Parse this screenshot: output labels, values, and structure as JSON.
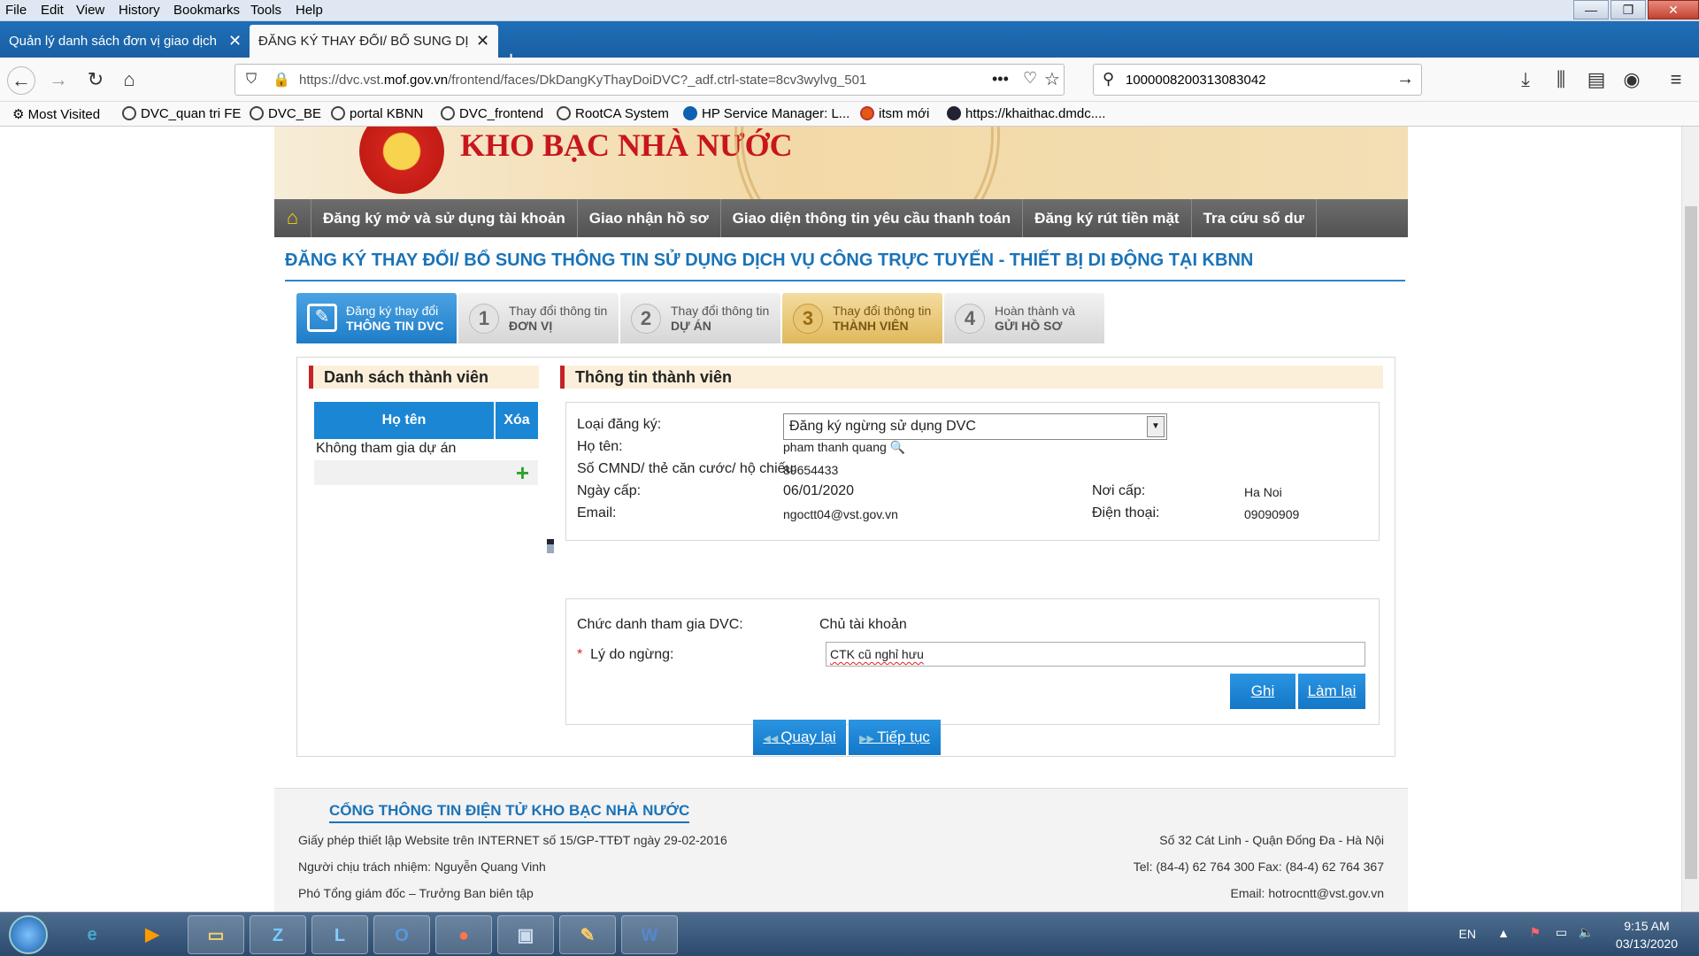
{
  "browser": {
    "menu": [
      "File",
      "Edit",
      "View",
      "History",
      "Bookmarks",
      "Tools",
      "Help"
    ],
    "tabs": [
      {
        "title": "Quản lý danh sách đơn vị giao dịch",
        "active": false
      },
      {
        "title": "ĐĂNG KÝ THAY ĐỔI/ BỔ SUNG DỊCH VỤ",
        "active": true
      }
    ],
    "url_prefix": "https://dvc.vst.",
    "url_domain": "mof.gov.vn",
    "url_rest": "/frontend/faces/DkDangKyThayDoiDVC?_adf.ctrl-state=8cv3wylvg_501",
    "search_value": "1000008200313083042",
    "bookmarks": [
      "Most Visited",
      "DVC_quan tri FE",
      "DVC_BE",
      "portal KBNN",
      "DVC_frontend",
      "RootCA System",
      "HP Service Manager: L...",
      "itsm mới",
      "https://khaithac.dmdc...."
    ]
  },
  "site": {
    "banner_title": "KHO BẠC NHÀ NƯỚC",
    "menu": [
      "Đăng ký mở và sử dụng tài khoản",
      "Giao nhận hồ sơ",
      "Giao diện thông tin yêu cầu thanh toán",
      "Đăng ký rút tiền mặt",
      "Tra cứu số dư"
    ]
  },
  "page": {
    "title": "ĐĂNG KÝ THAY ĐỔI/ BỔ SUNG THÔNG TIN SỬ DỤNG DỊCH VỤ CÔNG TRỰC TUYẾN - THIẾT BỊ DI ĐỘNG TẠI KBNN",
    "steps": [
      {
        "num": "",
        "line1": "Đăng ký thay đổi",
        "line2": "THÔNG TIN DVC"
      },
      {
        "num": "1",
        "line1": "Thay đổi thông tin",
        "line2": "ĐƠN VỊ"
      },
      {
        "num": "2",
        "line1": "Thay đổi thông tin",
        "line2": "DỰ ÁN"
      },
      {
        "num": "3",
        "line1": "Thay đổi thông tin",
        "line2": "THÀNH VIÊN"
      },
      {
        "num": "4",
        "line1": "Hoàn thành và",
        "line2": "GỬI HỒ SƠ"
      }
    ],
    "member_list": {
      "header": "Danh sách thành viên",
      "col_name": "Họ tên",
      "col_delete": "Xóa",
      "rows": [
        "Không tham gia dự án"
      ]
    },
    "member_info": {
      "header": "Thông tin thành viên",
      "loai_dang_ky_label": "Loại đăng ký:",
      "loai_dang_ky_value": "Đăng ký ngừng sử dụng DVC",
      "ho_ten_label": "Họ tên:",
      "ho_ten_value": "pham thanh quang",
      "cmnd_label": "Số CMND/ thẻ căn cước/ hộ chiếu:",
      "cmnd_value": "89654433",
      "ngay_cap_label": "Ngày cấp:",
      "ngay_cap_value": "06/01/2020",
      "noi_cap_label": "Nơi cấp:",
      "noi_cap_value": "Ha Noi",
      "email_label": "Email:",
      "email_value": "ngoctt04@vst.gov.vn",
      "dien_thoai_label": "Điện thoại:",
      "dien_thoai_value": "09090909",
      "chuc_danh_label": "Chức danh tham gia DVC:",
      "chuc_danh_value": "Chủ tài khoản",
      "ly_do_label": "Lý do ngừng:",
      "required_mark": "*",
      "ly_do_value": "CTK cũ nghỉ hưu",
      "save_label": "Ghi",
      "reset_label": "Làm lại"
    },
    "back_label": "Quay lại",
    "next_label": "Tiếp tục"
  },
  "footer": {
    "title": "CỔNG THÔNG TIN ĐIỆN TỬ KHO BẠC NHÀ NƯỚC",
    "left": [
      "Giấy phép thiết lập Website trên INTERNET số 15/GP-TTĐT ngày 29-02-2016",
      "Người chịu trách nhiệm: Nguyễn Quang Vinh",
      "Phó Tổng giám đốc – Trưởng Ban biên tập"
    ],
    "right": [
      "Số 32 Cát Linh - Quận Đống Đa - Hà Nội",
      "Tel: (84-4) 62 764 300 Fax: (84-4) 62 764 367",
      "Email: hotrocntt@vst.gov.vn"
    ]
  },
  "taskbar": {
    "lang": "EN",
    "time": "9:15 AM",
    "date": "03/13/2020",
    "apps": [
      "ie-icon",
      "media-player-icon",
      "explorer-icon",
      "zalo-icon",
      "lync-icon",
      "outlook-icon",
      "firefox-icon",
      "network-icon",
      "paint-icon",
      "word-icon"
    ]
  }
}
